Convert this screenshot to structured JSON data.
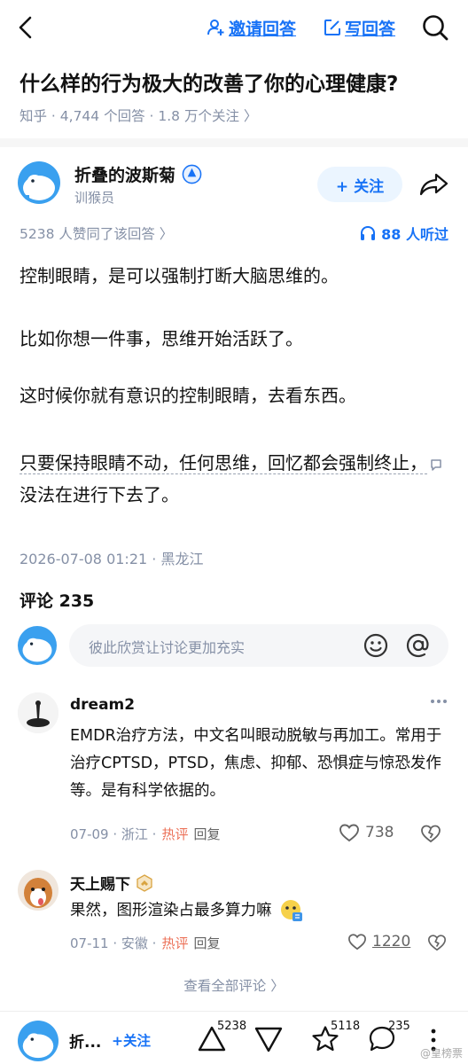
{
  "header": {
    "back_icon": "chevron-left-icon",
    "invite_label": "邀请回答",
    "write_label": "写回答",
    "search_icon": "search-icon"
  },
  "question": {
    "title": "什么样的行为极大的改善了你的心理健康?",
    "meta": "知乎 · 4,744 个回答 · 1.8 万个关注 〉"
  },
  "author": {
    "name": "折叠的波斯菊",
    "title": "训猴员",
    "follow_label": "+ 关注",
    "upvote_line": "5238 人赞同了该回答 〉",
    "listened": "88 人听过"
  },
  "answer": {
    "p1": "控制眼睛，是可以强制打断大脑思维的。",
    "p2": "比如你想一件事，思维开始活跃了。",
    "p3": "这时候你就有意识的控制眼睛，去看东西。",
    "p4a": "只要保持眼睛不动，任何思维，回忆都会强制终止，",
    "p4b": "没法在进行下去了。",
    "date": "2026-07-08 01:21 · 黑龙江"
  },
  "comments": {
    "heading": "评论 235",
    "input_placeholder": "彼此欣赏让讨论更加充实",
    "items": [
      {
        "name": "dream2",
        "text": "EMDR治疗方法，中文名叫眼动脱敏与再加工。常用于治疗CPTSD，PTSD，焦虑、抑郁、恐惧症与惊恐发作等。是有科学依据的。",
        "date": "07-09 · 浙江 ·",
        "hot": "热评",
        "reply": "回复",
        "likes": "738"
      },
      {
        "name": "天上赐下",
        "text": "果然，图形渲染占最多算力嘛",
        "date": "07-11 · 安徽 ·",
        "hot": "热评",
        "reply": "回复",
        "likes": "1220"
      }
    ],
    "view_all": "查看全部评论 〉"
  },
  "bottom_bar": {
    "name": "折...",
    "follow_label": "+关注",
    "upvotes": "5238",
    "favorites": "5118",
    "comments": "235"
  },
  "watermark": "@皇榜票",
  "colors": {
    "accent": "#1772f6",
    "hot": "#ec7259",
    "meta": "#8590a6"
  }
}
